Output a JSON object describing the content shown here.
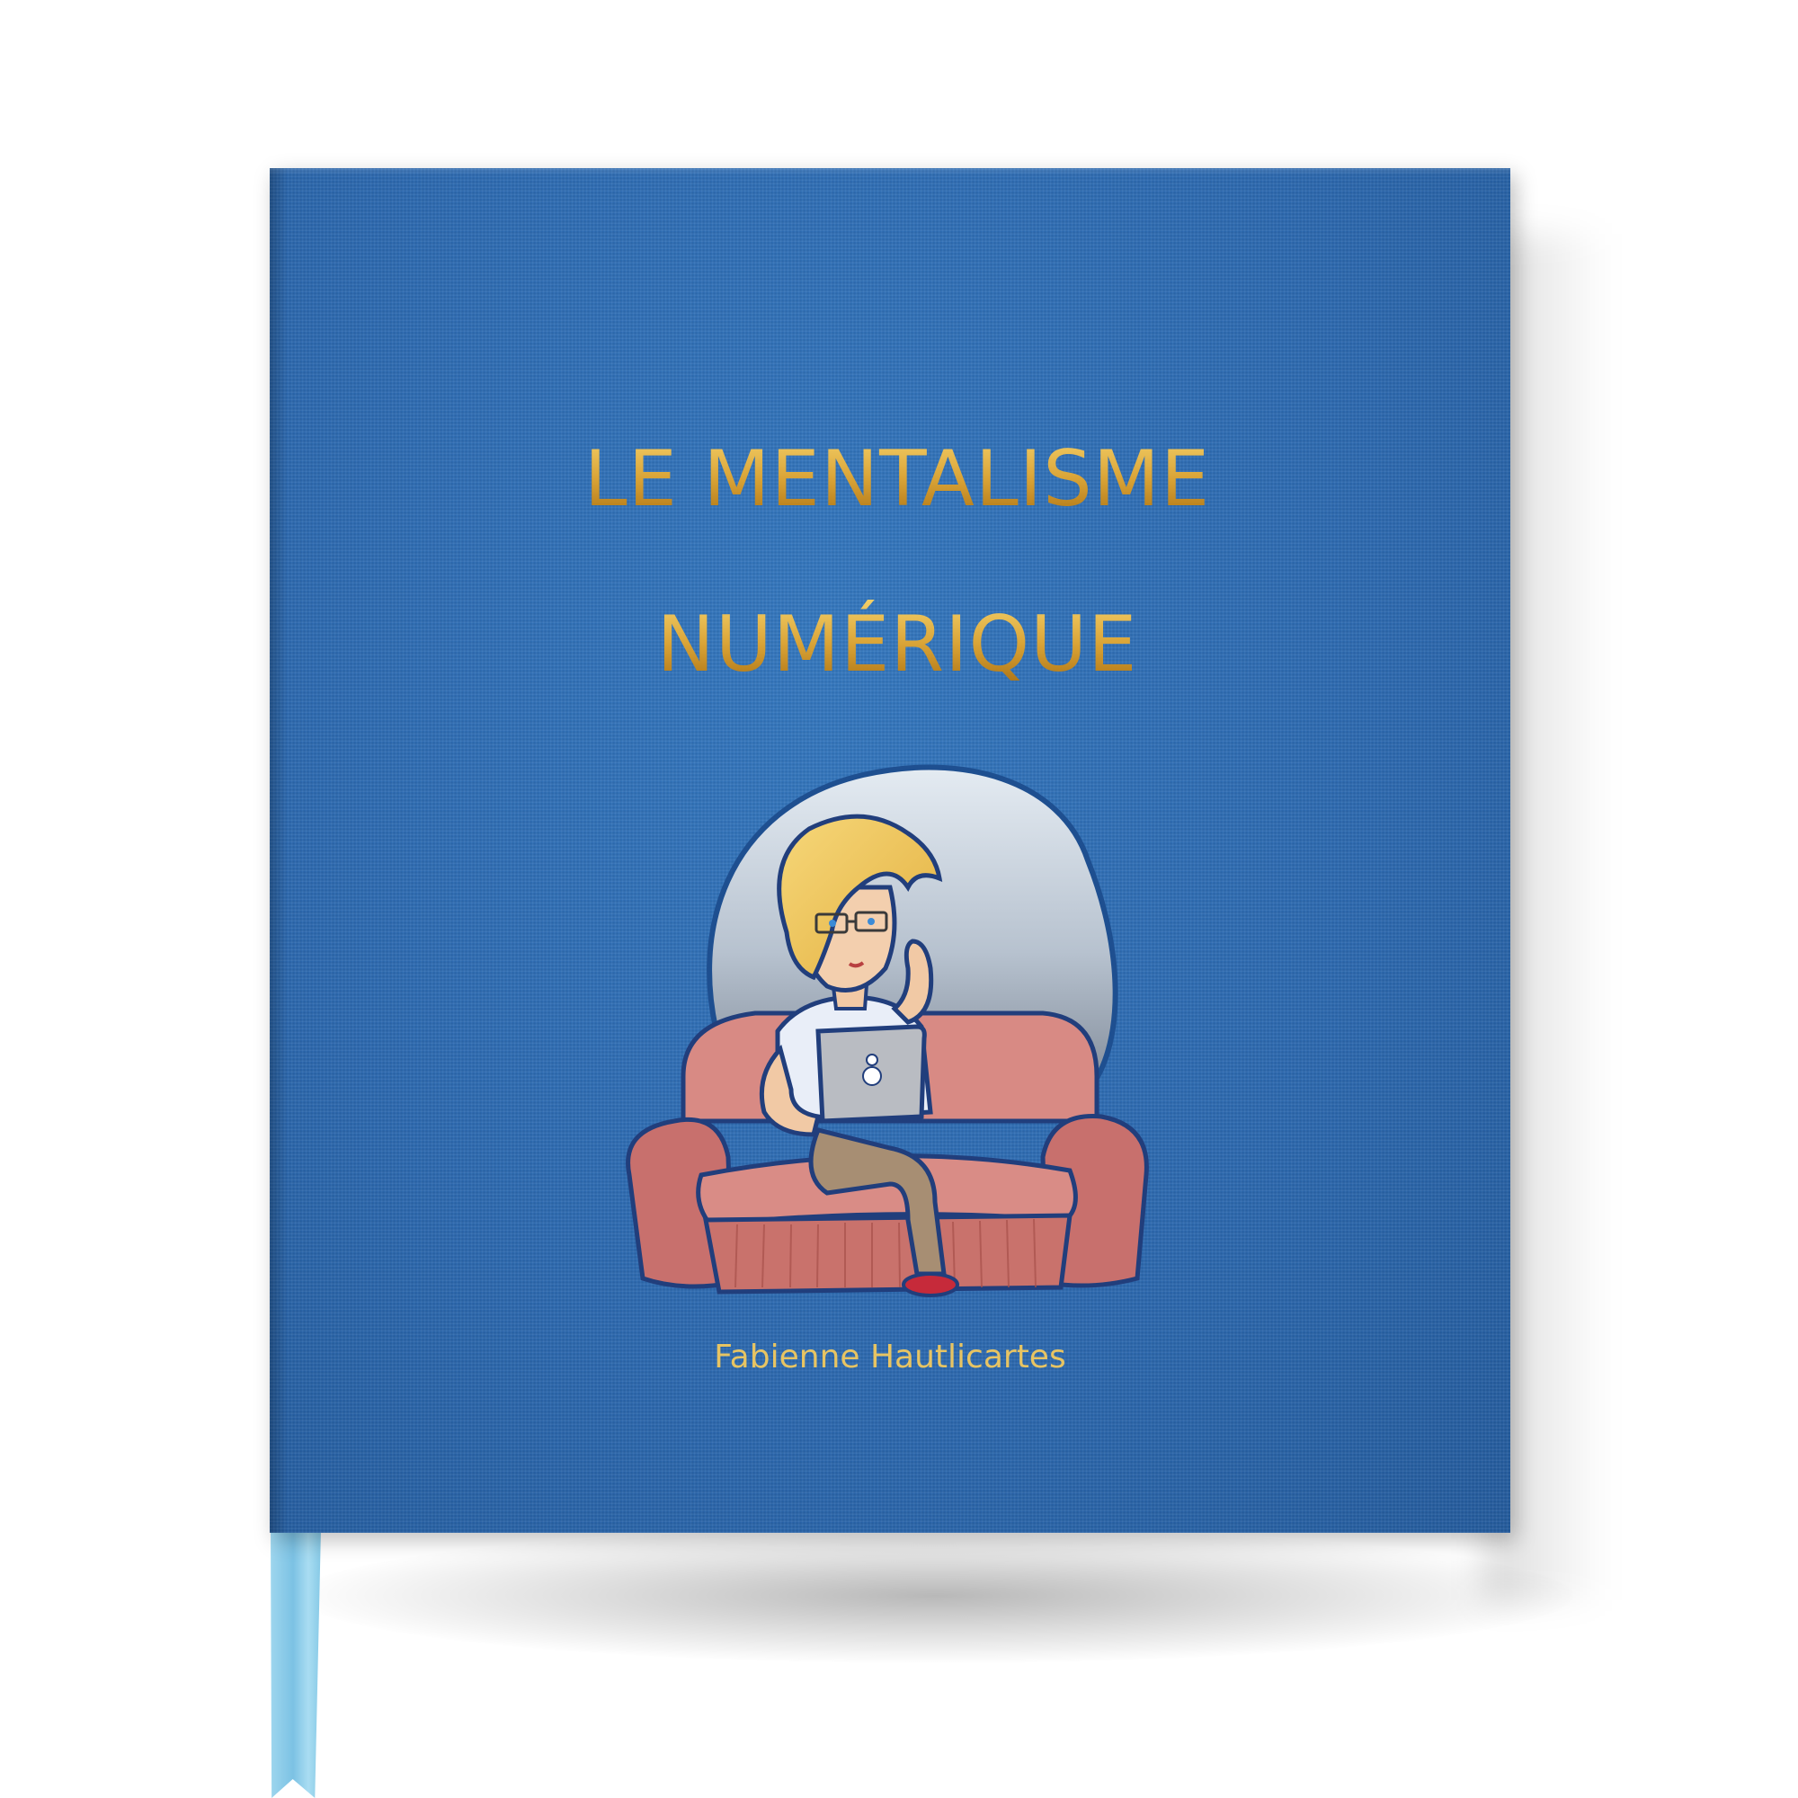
{
  "cover": {
    "title_line_1": "LE MENTALISME",
    "title_line_2": "NUMÉRIQUE",
    "author": "Fabienne Hautlicartes"
  },
  "colors": {
    "cover_blue": "#2e6db6",
    "title_gold": "#d4a033",
    "author_gold": "#e7c463",
    "ribbon_blue": "#8ecfea",
    "sofa_pink": "#d88a84"
  },
  "illustration": {
    "subject": "woman-with-laptop-on-sofa"
  }
}
